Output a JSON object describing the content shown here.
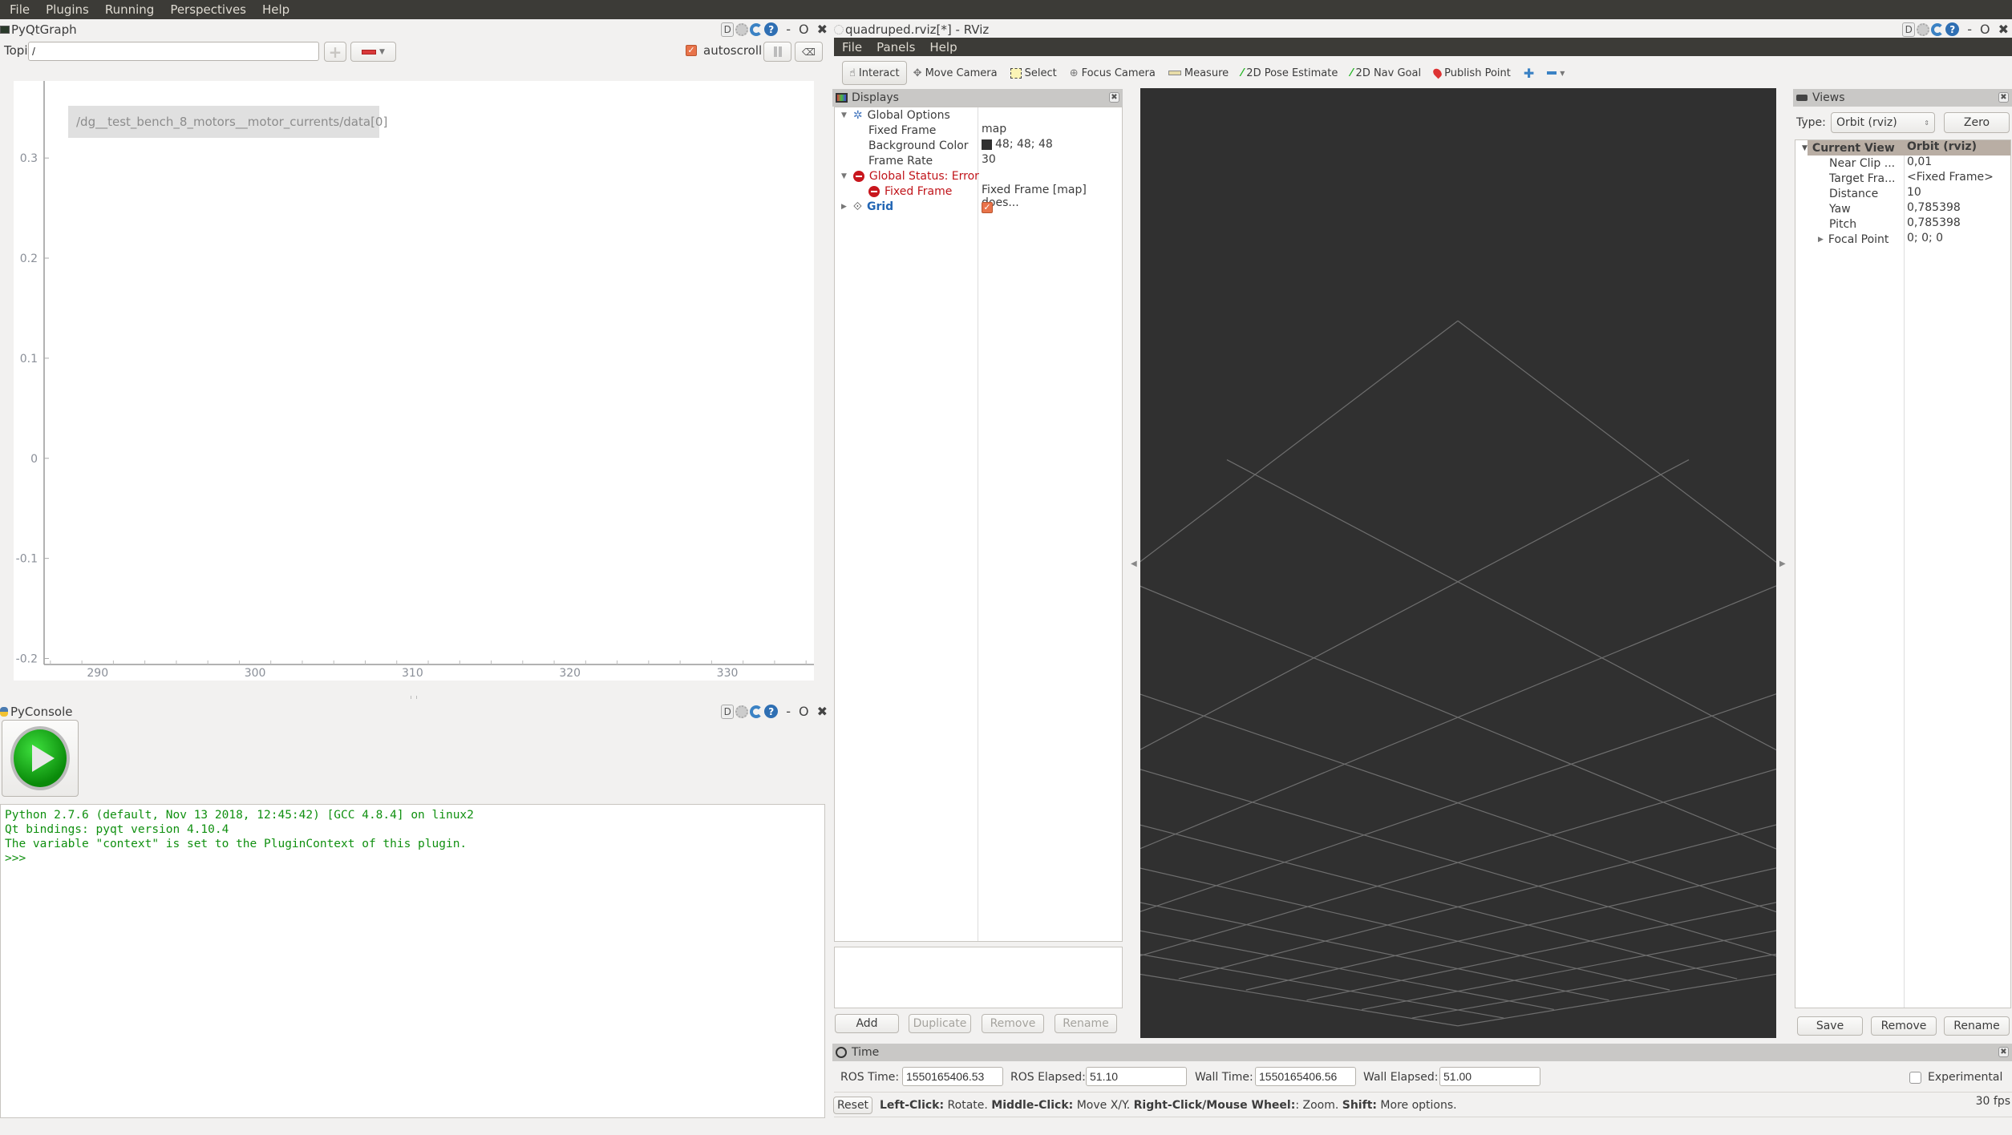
{
  "menubar": {
    "items": [
      "File",
      "Plugins",
      "Running",
      "Perspectives",
      "Help"
    ]
  },
  "pyqtgraph": {
    "title": "PyQtGraph",
    "topic_label": "Topic",
    "topic_value": "/",
    "autoscroll_label": "autoscroll",
    "autoscroll_checked": true,
    "dock_controls": {
      "d_label": "D",
      "help_label": "?",
      "min_label": "-",
      "float_label": "O",
      "close_label": "✖"
    }
  },
  "chart_data": {
    "type": "line",
    "title": "",
    "xlabel": "",
    "ylabel": "",
    "xlim": [
      286.6,
      335.5
    ],
    "ylim": [
      -0.206,
      0.377
    ],
    "x_ticks": [
      290,
      300,
      310,
      320,
      330
    ],
    "x_tick_labels": [
      "290",
      "300",
      "310",
      "320",
      "330"
    ],
    "y_ticks": [
      0.3,
      0.2,
      0.1,
      0,
      -0.1,
      -0.2
    ],
    "y_tick_labels": [
      "0.3",
      "0.2",
      "0.1",
      "0",
      "-0.1",
      "-0.2"
    ],
    "grid": false,
    "legend": {
      "placement": "top-left",
      "entries": [
        "/dg__test_bench_8_motors__motor_currents/data[0]"
      ]
    },
    "series": [
      {
        "name": "/dg__test_bench_8_motors__motor_currents/data[0]",
        "color": "#0000ff",
        "x": [],
        "y": []
      }
    ]
  },
  "pyconsole": {
    "title": "PyConsole",
    "lines": [
      "Python 2.7.6 (default, Nov 13 2018, 12:45:42) [GCC 4.8.4] on linux2",
      "Qt bindings: pyqt version 4.10.4",
      "The variable \"context\" is set to the PluginContext of this plugin.",
      ">>>"
    ]
  },
  "rviz": {
    "title": "quadruped.rviz[*] - RViz",
    "menubar": [
      "File",
      "Panels",
      "Help"
    ],
    "toolbar": [
      "Interact",
      "Move Camera",
      "Select",
      "Focus Camera",
      "Measure",
      "2D Pose Estimate",
      "2D Nav Goal",
      "Publish Point"
    ],
    "displays": {
      "title": "Displays",
      "rows": [
        {
          "label": "Global Options",
          "value": ""
        },
        {
          "label": "Fixed Frame",
          "value": "map"
        },
        {
          "label": "Background Color",
          "value": "48; 48; 48"
        },
        {
          "label": "Frame Rate",
          "value": "30"
        },
        {
          "label": "Global Status: Error",
          "value": ""
        },
        {
          "label": "Fixed Frame",
          "value": "Fixed Frame [map] does..."
        },
        {
          "label": "Grid",
          "value": ""
        }
      ],
      "buttons": [
        "Add",
        "Duplicate",
        "Remove",
        "Rename"
      ]
    },
    "views": {
      "title": "Views",
      "type_label": "Type:",
      "type_value": "Orbit (rviz)",
      "zero_label": "Zero",
      "header": {
        "label": "Current View",
        "value": "Orbit (rviz)"
      },
      "rows": [
        {
          "label": "Near Clip ...",
          "value": "0,01"
        },
        {
          "label": "Target Fra...",
          "value": "<Fixed Frame>"
        },
        {
          "label": "Distance",
          "value": "10"
        },
        {
          "label": "Yaw",
          "value": "0,785398"
        },
        {
          "label": "Pitch",
          "value": "0,785398"
        },
        {
          "label": "Focal Point",
          "value": "0; 0; 0"
        }
      ],
      "buttons": [
        "Save",
        "Remove",
        "Rename"
      ]
    },
    "time": {
      "title": "Time",
      "ros_time_label": "ROS Time:",
      "ros_time": "1550165406.53",
      "ros_elapsed_label": "ROS Elapsed:",
      "ros_elapsed": "51.10",
      "wall_time_label": "Wall Time:",
      "wall_time": "1550165406.56",
      "wall_elapsed_label": "Wall Elapsed:",
      "wall_elapsed": "51.00",
      "experimental_label": "Experimental"
    },
    "status": {
      "reset_label": "Reset",
      "parts": [
        {
          "bold": "Left-Click:",
          "text": " Rotate. "
        },
        {
          "bold": "Middle-Click:",
          "text": " Move X/Y. "
        },
        {
          "bold": "Right-Click/Mouse Wheel:",
          "text": ": Zoom. "
        },
        {
          "bold": "Shift:",
          "text": " More options."
        }
      ],
      "fps": "30 fps"
    }
  }
}
